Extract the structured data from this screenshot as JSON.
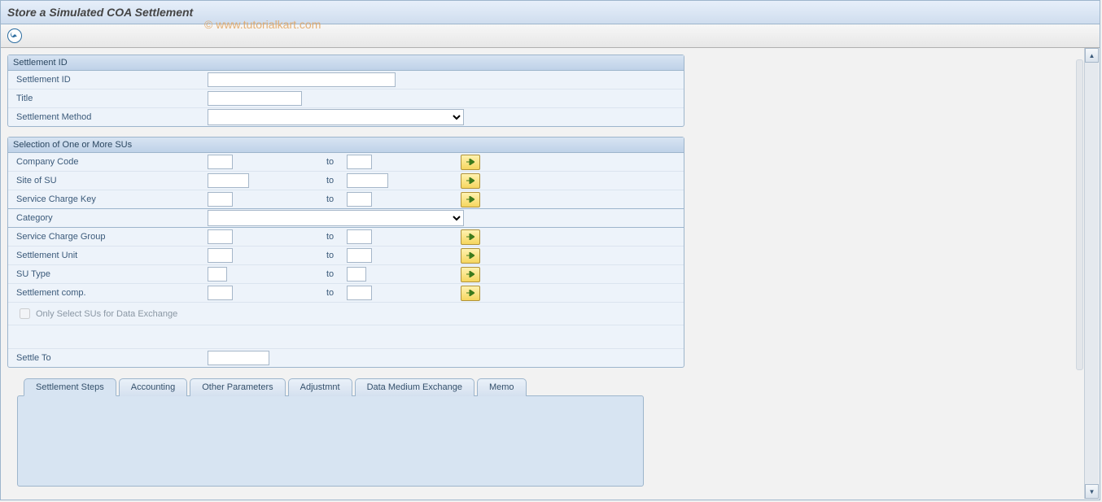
{
  "title": "Store a Simulated COA Settlement",
  "watermark": "© www.tutorialkart.com",
  "group1": {
    "header": "Settlement ID",
    "rows": {
      "settlement_id": "Settlement ID",
      "title_lbl": "Title",
      "method": "Settlement Method"
    }
  },
  "group2": {
    "header": "Selection of One or More SUs",
    "labels": {
      "company_code": "Company Code",
      "site_su": "Site of SU",
      "service_charge_key": "Service Charge Key",
      "category": "Category",
      "service_charge_group": "Service Charge Group",
      "settlement_unit": "Settlement Unit",
      "su_type": "SU Type",
      "settlement_comp": "Settlement comp.",
      "only_select": "Only Select SUs for Data Exchange",
      "settle_to": "Settle To"
    },
    "to": "to"
  },
  "tabs": [
    "Settlement Steps",
    "Accounting",
    "Other Parameters",
    "Adjustmnt",
    "Data Medium Exchange",
    "Memo"
  ]
}
